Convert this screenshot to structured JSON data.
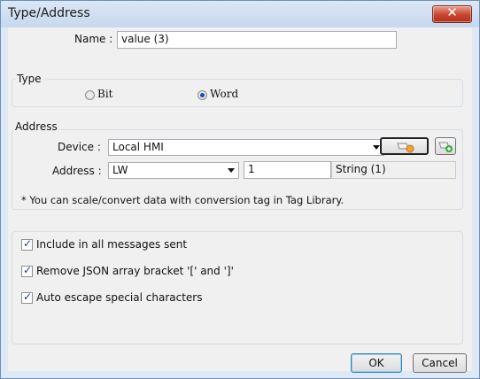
{
  "window": {
    "title": "Type/Address",
    "close_symbol": "✕"
  },
  "name": {
    "label": "Name :",
    "value": "value (3)"
  },
  "type_group": {
    "title": "Type",
    "options": [
      {
        "label": "Bit",
        "selected": false
      },
      {
        "label": "Word",
        "selected": true
      }
    ]
  },
  "address_group": {
    "title": "Address",
    "device_label": "Device :",
    "device_value": "Local HMI",
    "address_label": "Address :",
    "address_type": "LW",
    "address_value": "1",
    "format": "String (1)",
    "note": "* You can scale/convert data with conversion tag in Tag Library."
  },
  "options": [
    {
      "label": "Include in all messages sent",
      "checked": true
    },
    {
      "label": "Remove JSON array bracket '[' and ']'",
      "checked": true
    },
    {
      "label": "Auto escape special characters",
      "checked": true
    }
  ],
  "buttons": {
    "ok": "OK",
    "cancel": "Cancel"
  },
  "icons": {
    "device_settings": "tag-settings-icon",
    "add_device": "add-tag-icon"
  }
}
